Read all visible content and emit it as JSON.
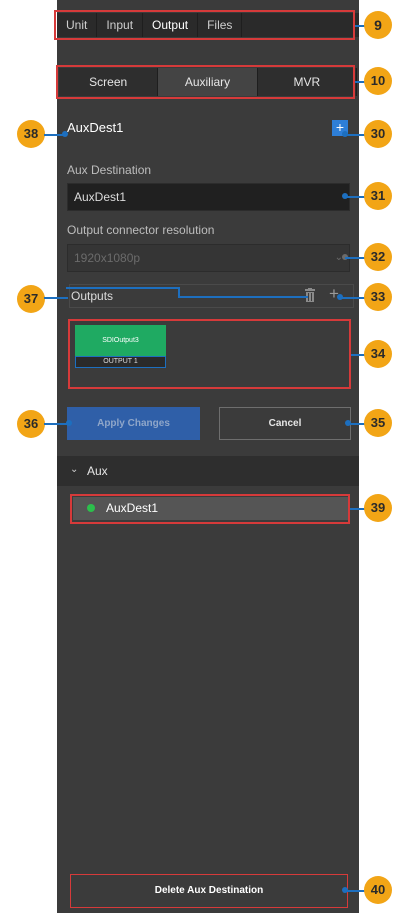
{
  "top_tabs": [
    "Unit",
    "Input",
    "Output",
    "Files"
  ],
  "sub_tabs": [
    "Screen",
    "Auxiliary",
    "MVR"
  ],
  "aux_name": "AuxDest1",
  "add_button": "+",
  "aux_destination": {
    "label": "Aux Destination",
    "value": "AuxDest1"
  },
  "resolution": {
    "label": "Output connector resolution",
    "value": "1920x1080p"
  },
  "outputs": {
    "label": "Outputs",
    "add": "+"
  },
  "output_card": {
    "name": "SDIOutput3",
    "connector": "OUTPUT 1"
  },
  "buttons": {
    "apply": "Apply Changes",
    "cancel": "Cancel",
    "delete": "Delete Aux Destination"
  },
  "aux_section": {
    "label": "Aux",
    "item": "AuxDest1"
  },
  "callouts": [
    "9",
    "10",
    "38",
    "30",
    "31",
    "32",
    "37",
    "33",
    "34",
    "36",
    "35",
    "39",
    "40"
  ],
  "colors": {
    "panel": "#3b3b3b",
    "accent": "#2e7fd8",
    "card": "#1faa62",
    "status_dot": "#2cbf4c",
    "badge": "#f2a516",
    "frame": "#d63a3a"
  },
  "icons": {
    "trash": "trash-icon",
    "aux_expand": "chevron-down-icon"
  }
}
